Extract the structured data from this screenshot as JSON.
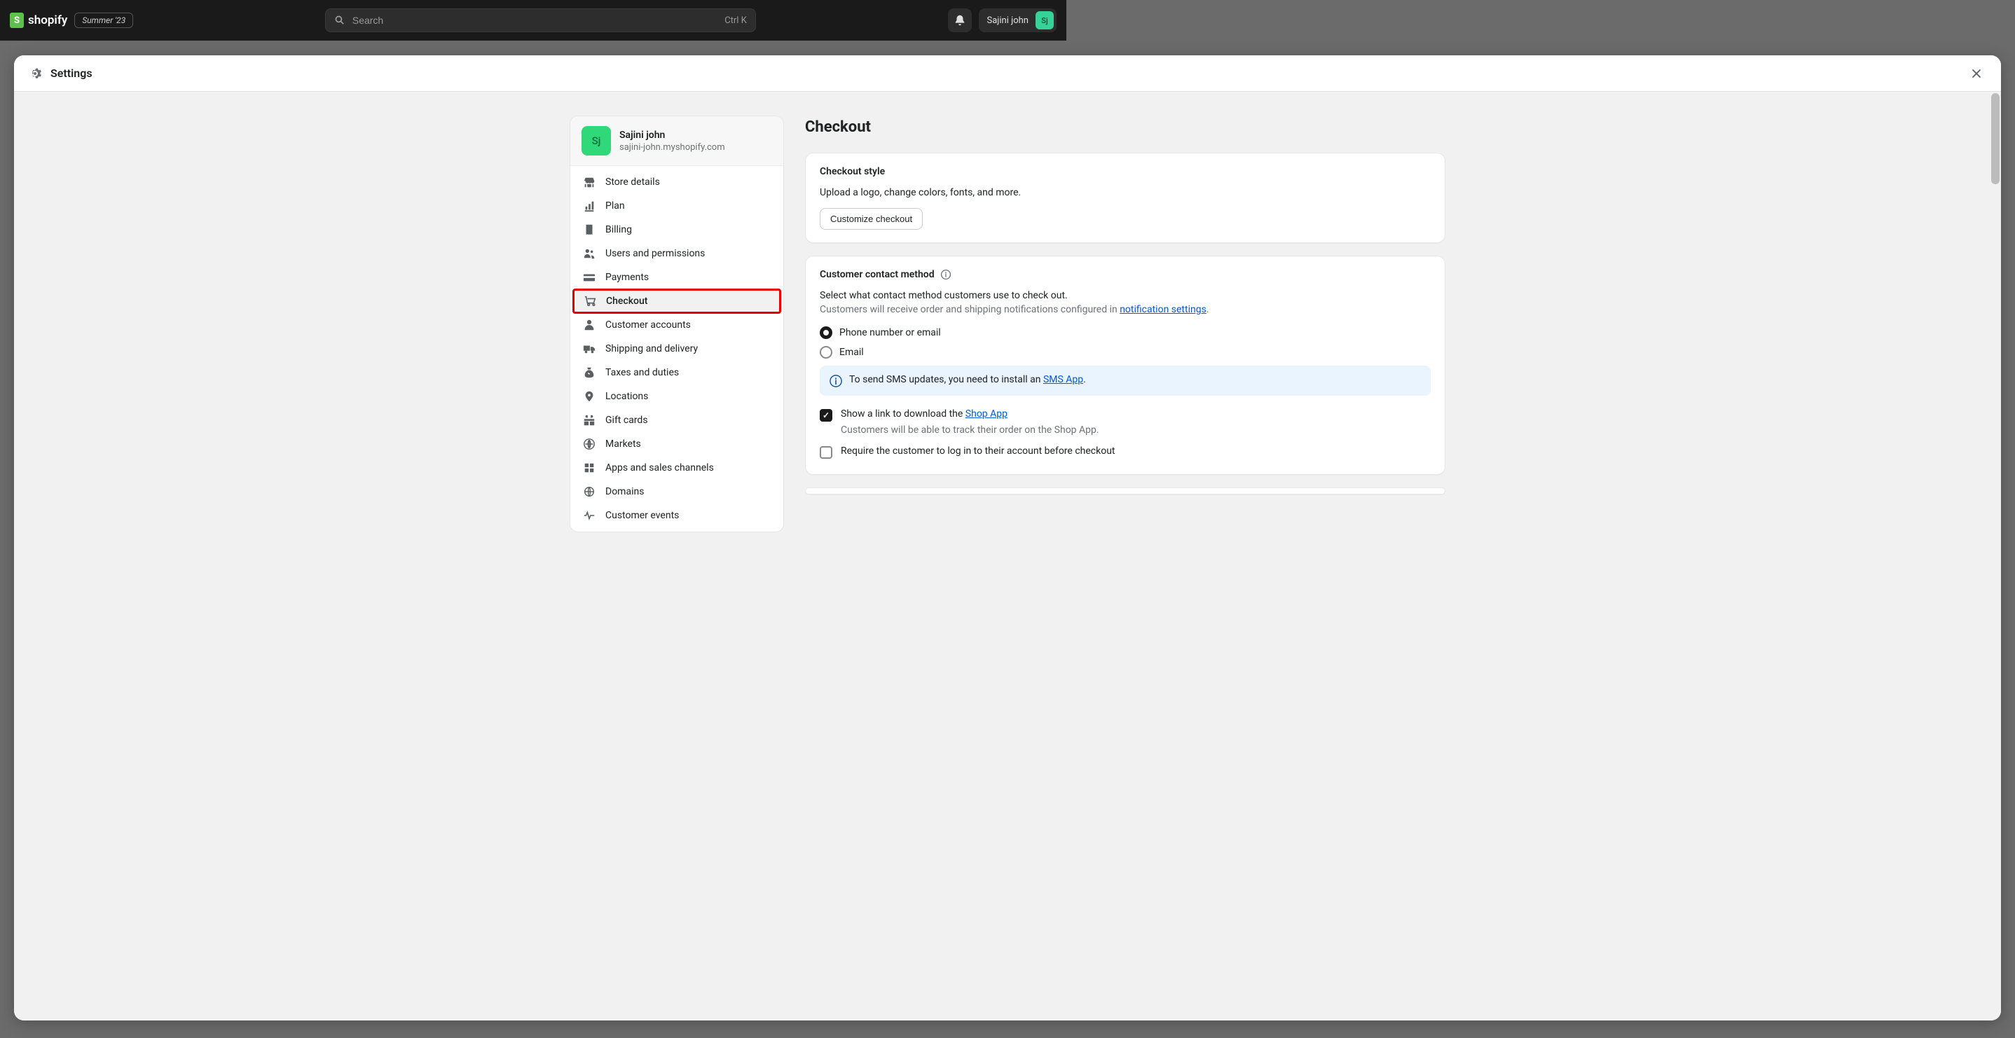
{
  "topbar": {
    "brand": "shopify",
    "season_badge": "Summer '23",
    "search_placeholder": "Search",
    "search_shortcut": "Ctrl K",
    "user_name": "Sajini john",
    "user_initials": "Sj"
  },
  "modal": {
    "title": "Settings"
  },
  "store": {
    "initials": "Sj",
    "name": "Sajini john",
    "url": "sajini-john.myshopify.com"
  },
  "nav": {
    "store_details": "Store details",
    "plan": "Plan",
    "billing": "Billing",
    "users": "Users and permissions",
    "payments": "Payments",
    "checkout": "Checkout",
    "customer_accounts": "Customer accounts",
    "shipping": "Shipping and delivery",
    "taxes": "Taxes and duties",
    "locations": "Locations",
    "gift_cards": "Gift cards",
    "markets": "Markets",
    "apps": "Apps and sales channels",
    "domains": "Domains",
    "customer_events": "Customer events"
  },
  "page": {
    "heading": "Checkout"
  },
  "checkout_style": {
    "title": "Checkout style",
    "desc": "Upload a logo, change colors, fonts, and more.",
    "button": "Customize checkout"
  },
  "contact": {
    "title": "Customer contact method",
    "lead": "Select what contact method customers use to check out.",
    "sub_pre": "Customers will receive order and shipping notifications configured in ",
    "sub_link": "notification settings",
    "sub_post": ".",
    "opt_phone_email": "Phone number or email",
    "opt_email": "Email",
    "banner_pre": "To send SMS updates, you need to install an ",
    "banner_link": "SMS App",
    "banner_post": ".",
    "show_link_pre": "Show a link to download the ",
    "show_link_link": "Shop App",
    "show_link_sub": "Customers will be able to track their order on the Shop App.",
    "require_login": "Require the customer to log in to their account before checkout"
  }
}
